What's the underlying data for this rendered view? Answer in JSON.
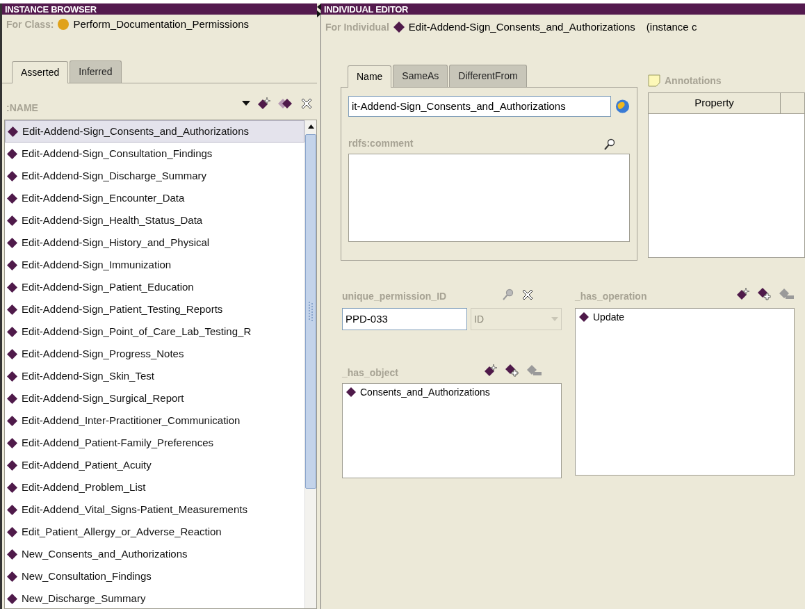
{
  "instance_browser": {
    "title": "INSTANCE BROWSER",
    "for_class_label": "For Class:",
    "class_name": "Perform_Documentation_Permissions",
    "tabs": [
      {
        "label": "Asserted",
        "selected": true
      },
      {
        "label": "Inferred",
        "selected": false
      }
    ],
    "column_header": ":NAME",
    "instances": [
      {
        "name": "Edit-Addend-Sign_Consents_and_Authorizations",
        "selected": true
      },
      {
        "name": "Edit-Addend-Sign_Consultation_Findings",
        "selected": false
      },
      {
        "name": "Edit-Addend-Sign_Discharge_Summary",
        "selected": false
      },
      {
        "name": "Edit-Addend-Sign_Encounter_Data",
        "selected": false
      },
      {
        "name": "Edit-Addend-Sign_Health_Status_Data",
        "selected": false
      },
      {
        "name": "Edit-Addend-Sign_History_and_Physical",
        "selected": false
      },
      {
        "name": "Edit-Addend-Sign_Immunization",
        "selected": false
      },
      {
        "name": "Edit-Addend-Sign_Patient_Education",
        "selected": false
      },
      {
        "name": "Edit-Addend-Sign_Patient_Testing_Reports",
        "selected": false
      },
      {
        "name": "Edit-Addend-Sign_Point_of_Care_Lab_Testing_R",
        "selected": false
      },
      {
        "name": "Edit-Addend-Sign_Progress_Notes",
        "selected": false
      },
      {
        "name": "Edit-Addend-Sign_Skin_Test",
        "selected": false
      },
      {
        "name": "Edit-Addend-Sign_Surgical_Report",
        "selected": false
      },
      {
        "name": "Edit-Addend_Inter-Practitioner_Communication",
        "selected": false
      },
      {
        "name": "Edit-Addend_Patient-Family_Preferences",
        "selected": false
      },
      {
        "name": "Edit-Addend_Patient_Acuity",
        "selected": false
      },
      {
        "name": "Edit-Addend_Problem_List",
        "selected": false
      },
      {
        "name": "Edit-Addend_Vital_Signs-Patient_Measurements",
        "selected": false
      },
      {
        "name": "Edit_Patient_Allergy_or_Adverse_Reaction",
        "selected": false
      },
      {
        "name": "New_Consents_and_Authorizations",
        "selected": false
      },
      {
        "name": "New_Consultation_Findings",
        "selected": false
      },
      {
        "name": "New_Discharge_Summary",
        "selected": false
      }
    ]
  },
  "individual_editor": {
    "title": "INDIVIDUAL EDITOR",
    "for_individual_label": "For Individual",
    "individual_name": "Edit-Addend-Sign_Consents_and_Authorizations",
    "instance_of": "(instance c",
    "tabs": [
      {
        "label": "Name",
        "selected": true
      },
      {
        "label": "SameAs",
        "selected": false
      },
      {
        "label": "DifferentFrom",
        "selected": false
      }
    ],
    "name_value": "it-Addend-Sign_Consents_and_Authorizations",
    "comment_label": "rdfs:comment",
    "annotations": {
      "title": "Annotations",
      "columns": [
        "Property"
      ]
    },
    "unique_permission_id": {
      "label": "unique_permission_ID",
      "value": "PPD-033",
      "datatype": "ID"
    },
    "has_object": {
      "label": "_has_object",
      "items": [
        "Consents_and_Authorizations"
      ]
    },
    "has_operation": {
      "label": "_has_operation",
      "items": [
        "Update"
      ]
    }
  }
}
